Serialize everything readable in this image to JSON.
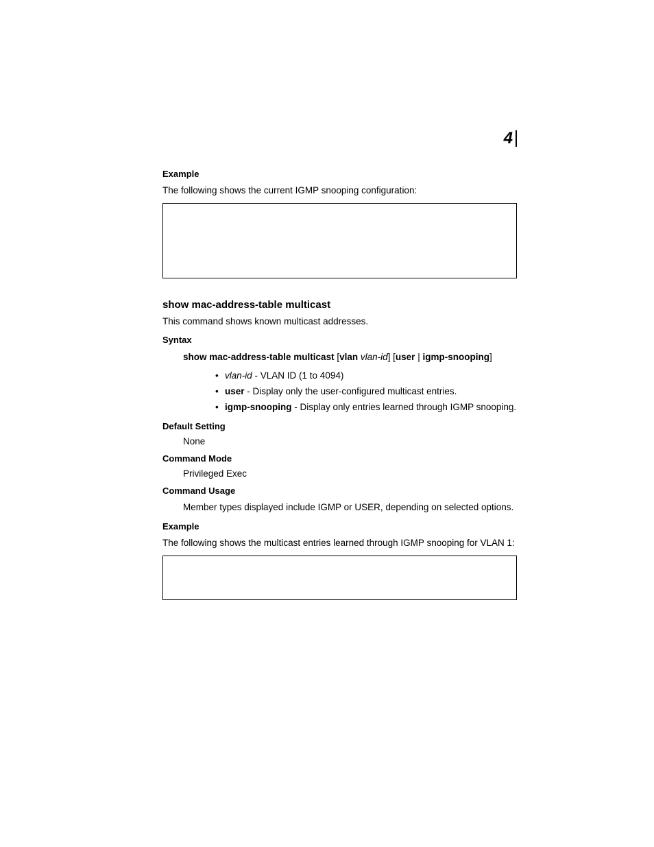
{
  "chapter": "4",
  "example1": {
    "heading": "Example",
    "intro": "The following shows the current IGMP snooping configuration:"
  },
  "section": {
    "title": "show mac-address-table multicast",
    "intro": "This command shows known multicast addresses."
  },
  "syntax": {
    "heading": "Syntax",
    "cmd_a": "show mac-address-table multicast",
    "bracket_open1": " [",
    "vlan": "vlan",
    "space1": " ",
    "vlan_id": "vlan-id",
    "bracket_close1": "] [",
    "user": "user",
    "pipe": " | ",
    "igmp": "igmp-snooping",
    "bracket_close2": "]",
    "bullets": [
      {
        "term": "vlan-id",
        "term_italic": true,
        "desc": " - VLAN ID (1 to 4094)"
      },
      {
        "term": "user",
        "term_italic": false,
        "desc": " - Display only the user-configured multicast entries."
      },
      {
        "term": "igmp-snooping",
        "term_italic": false,
        "desc": " - Display only entries learned through IGMP snooping."
      }
    ]
  },
  "default_setting": {
    "heading": "Default Setting",
    "value": "None"
  },
  "command_mode": {
    "heading": "Command Mode",
    "value": "Privileged Exec"
  },
  "command_usage": {
    "heading": "Command Usage",
    "value": "Member types displayed include IGMP or USER, depending on selected options."
  },
  "example2": {
    "heading": "Example",
    "intro": "The following shows the multicast entries learned through IGMP snooping for VLAN 1:"
  }
}
